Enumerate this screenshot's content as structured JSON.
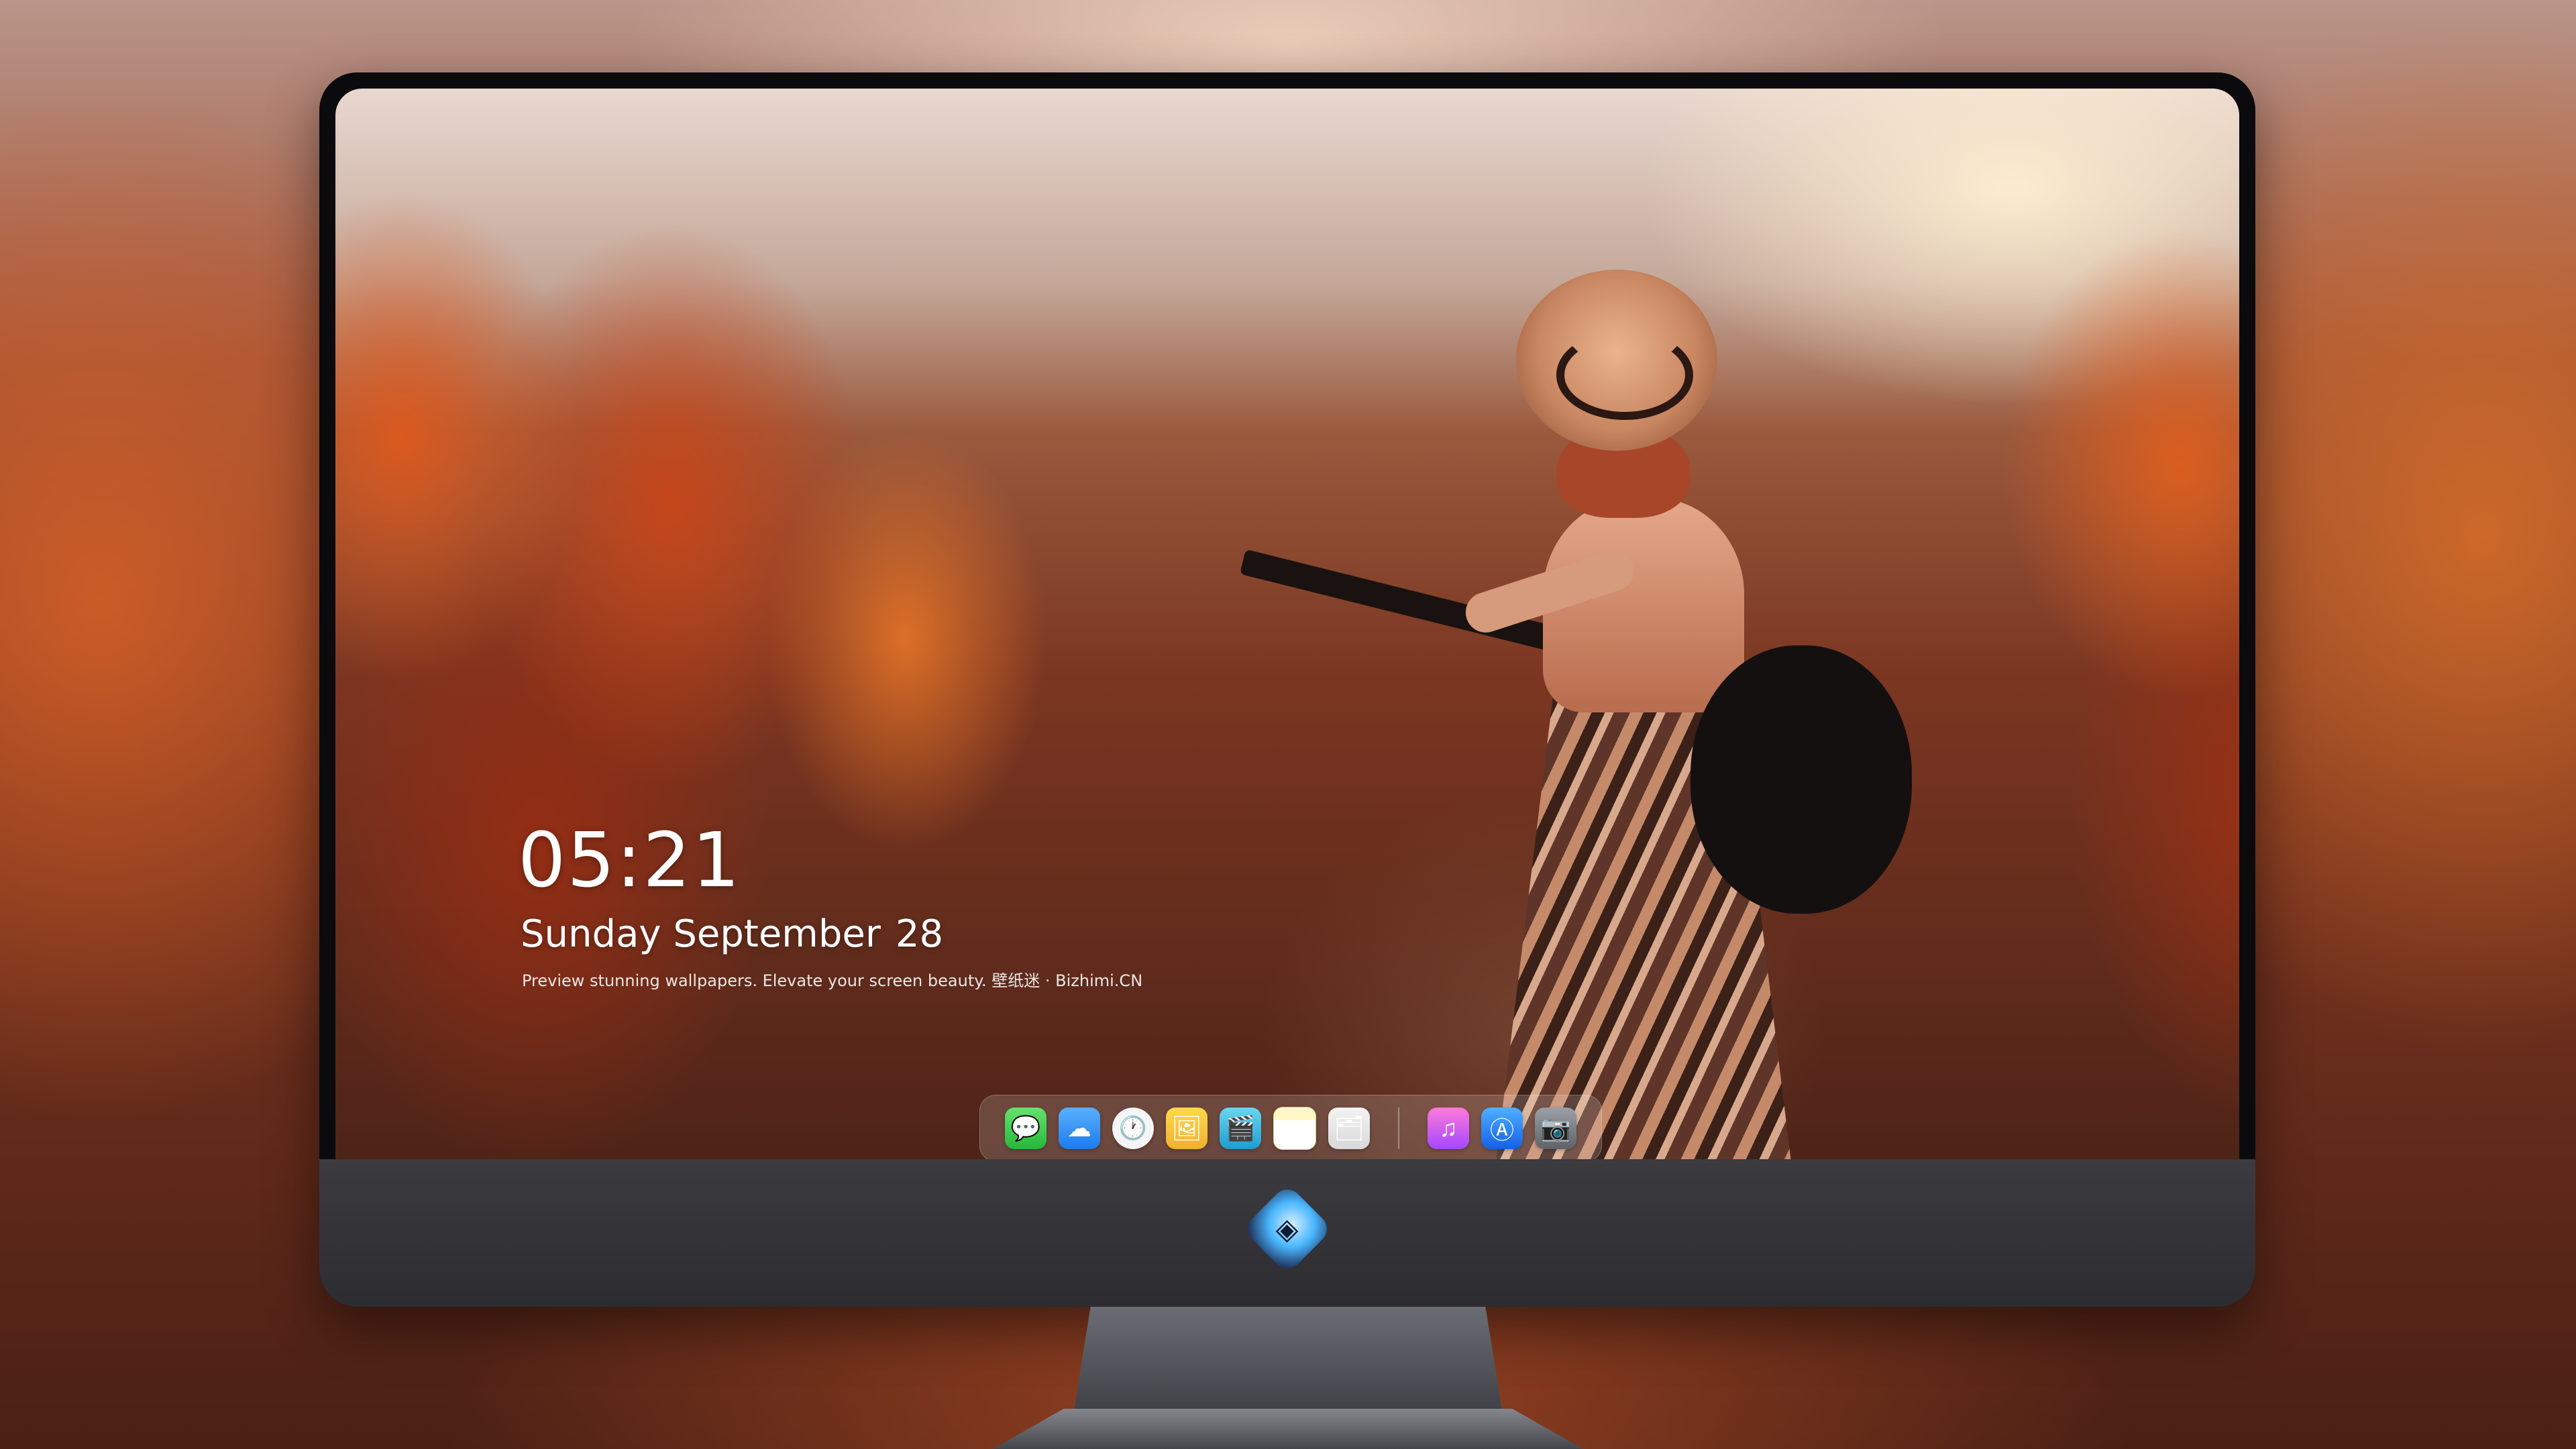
{
  "lock_screen": {
    "time": "05:21",
    "date_day": "Sunday September",
    "date_number": "28",
    "tagline": "Preview stunning wallpapers. Elevate your screen beauty. 壁纸迷 · Bizhimi.CN"
  },
  "dock": {
    "items": [
      {
        "name": "messages",
        "icon": "speech-bubble-icon",
        "glyph": "💬"
      },
      {
        "name": "weather",
        "icon": "cloud-icon",
        "glyph": "☁"
      },
      {
        "name": "clock",
        "icon": "clock-icon",
        "glyph": "🕐"
      },
      {
        "name": "preview",
        "icon": "preview-icon",
        "glyph": "🖼"
      },
      {
        "name": "clips",
        "icon": "clapperboard-icon",
        "glyph": "🎬"
      },
      {
        "name": "notes",
        "icon": "notes-icon",
        "glyph": ""
      },
      {
        "name": "photos",
        "icon": "photos-icon",
        "glyph": "🗂"
      },
      {
        "name": "music",
        "icon": "music-note-icon",
        "glyph": "♫"
      },
      {
        "name": "app-store",
        "icon": "app-store-icon",
        "glyph": "Ⓐ"
      },
      {
        "name": "camera",
        "icon": "camera-icon",
        "glyph": "📷"
      }
    ]
  },
  "monitor": {
    "logo_icon": "bizhimi-mascot-icon",
    "logo_glyph": "◈"
  },
  "colors": {
    "backdrop": "#7a3520",
    "bezel": "#0b0b0d",
    "chin": "#3b3b40"
  }
}
